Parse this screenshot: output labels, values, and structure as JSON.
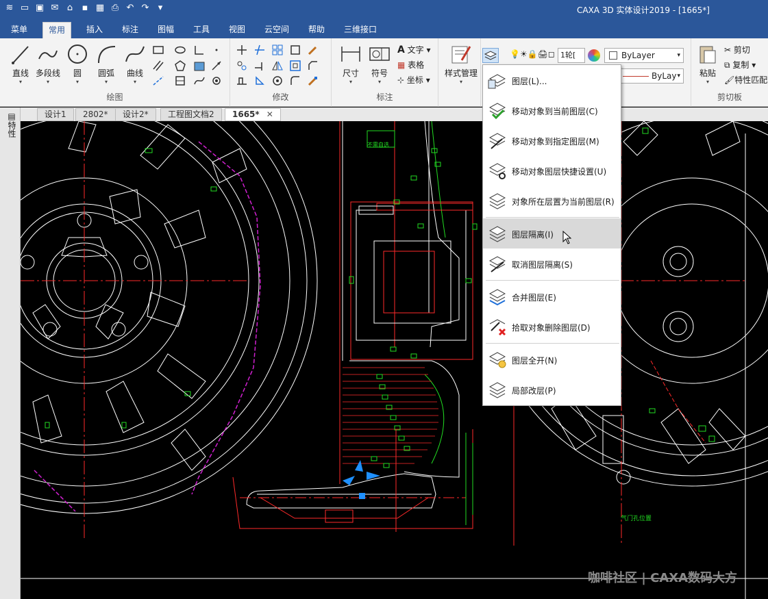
{
  "window": {
    "title": "CAXA 3D 实体设计2019 - [1665*]"
  },
  "menu_tabs": [
    {
      "label": "菜单"
    },
    {
      "label": "常用"
    },
    {
      "label": "插入"
    },
    {
      "label": "标注"
    },
    {
      "label": "图幅"
    },
    {
      "label": "工具"
    },
    {
      "label": "视图"
    },
    {
      "label": "云空间"
    },
    {
      "label": "帮助"
    },
    {
      "label": "三维接口"
    }
  ],
  "ribbon": {
    "draw_group": {
      "label": "绘图",
      "buttons": [
        "直线",
        "多段线",
        "圆",
        "圆弧",
        "曲线"
      ]
    },
    "modify_group": {
      "label": "修改"
    },
    "annotate_group": {
      "label": "标注",
      "buttons": [
        "尺寸",
        "符号"
      ],
      "small": [
        "文字",
        "表格",
        "坐标"
      ]
    },
    "style_group": {
      "label": "样式管理"
    },
    "layer_combo": "1轮[",
    "bylayer_color": "ByLayer",
    "bylayer_line": "ByLay",
    "clipboard_group": {
      "label": "剪切板",
      "paste": "粘贴",
      "small": [
        "剪切",
        "复制",
        "特性匹配"
      ]
    }
  },
  "doc_tabs": [
    "设计1",
    "2802*",
    "设计2*",
    "工程图文档2",
    "1665*"
  ],
  "sidebar": {
    "label": "特性"
  },
  "dropdown": {
    "items": [
      {
        "label": "图层(L)...",
        "icon": "layer-manager-icon"
      },
      {
        "label": "移动对象到当前图层(C)",
        "icon": "move-to-current-layer-icon"
      },
      {
        "label": "移动对象到指定图层(M)",
        "icon": "move-to-layer-icon"
      },
      {
        "label": "移动对象图层快捷设置(U)",
        "icon": "layer-quick-settings-icon"
      },
      {
        "label": "对象所在层置为当前图层(R)",
        "icon": "set-current-layer-icon"
      },
      {
        "label": "图层隔离(I)",
        "icon": "layer-isolate-icon"
      },
      {
        "label": "取消图层隔离(S)",
        "icon": "layer-unisolate-icon"
      },
      {
        "label": "合并图层(E)",
        "icon": "merge-layers-icon"
      },
      {
        "label": "拾取对象删除图层(D)",
        "icon": "delete-layer-icon"
      },
      {
        "label": "图层全开(N)",
        "icon": "layers-all-on-icon"
      },
      {
        "label": "局部改层(P)",
        "icon": "partial-change-layer-icon"
      }
    ]
  },
  "drawing_text": {
    "note_top": "不需自选",
    "note_bottom": "气门孔位置"
  },
  "watermark": "咖啡社区 | CAXA数码大方",
  "colors": {
    "title_bg": "#2b579a",
    "ribbon_bg": "#f3f3f3",
    "canvas_bg": "#000000",
    "line_white": "#ffffff",
    "line_red": "#ff2a2a",
    "line_green": "#22dd22",
    "line_magenta": "#d020d0",
    "accent_blue": "#1e90ff"
  }
}
